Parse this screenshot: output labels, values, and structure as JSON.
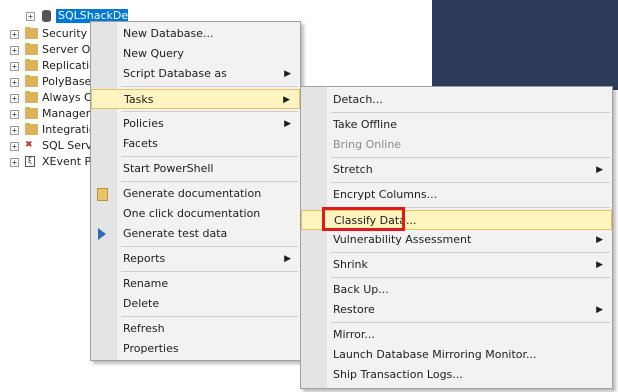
{
  "tree": {
    "database": "SQLShackDemo",
    "nodes": [
      "Security",
      "Server Obj",
      "Replicatio",
      "PolyBase",
      "Always Or",
      "Managem",
      "Integratio",
      "SQL Serve",
      "XEvent Pro"
    ]
  },
  "context_menu": {
    "items": {
      "new_database": "New Database...",
      "new_query": "New Query",
      "script_database_as": "Script Database as",
      "tasks": "Tasks",
      "policies": "Policies",
      "facets": "Facets",
      "start_powershell": "Start PowerShell",
      "generate_documentation": "Generate documentation",
      "one_click_documentation": "One click documentation",
      "generate_test_data": "Generate test data",
      "reports": "Reports",
      "rename": "Rename",
      "delete": "Delete",
      "refresh": "Refresh",
      "properties": "Properties"
    }
  },
  "tasks_submenu": {
    "items": {
      "detach": "Detach...",
      "take_offline": "Take Offline",
      "bring_online": "Bring Online",
      "stretch": "Stretch",
      "encrypt_columns": "Encrypt Columns...",
      "classify_data": "Classify Data...",
      "vulnerability_assessment": "Vulnerability Assessment",
      "shrink": "Shrink",
      "back_up": "Back Up...",
      "restore": "Restore",
      "mirror": "Mirror...",
      "launch_mirroring_monitor": "Launch Database Mirroring Monitor...",
      "ship_transaction_logs": "Ship Transaction Logs..."
    }
  },
  "icons": {
    "expand": "expand-icon",
    "database": "database-icon",
    "folder": "folder-icon",
    "submenu_arrow": "chevron-right-icon",
    "play": "play-icon",
    "document": "document-icon"
  },
  "colors": {
    "highlight": "#fdf4bf",
    "selection": "#0078d7",
    "callout": "#e0191b",
    "dark_panel": "#2d3b5a"
  }
}
